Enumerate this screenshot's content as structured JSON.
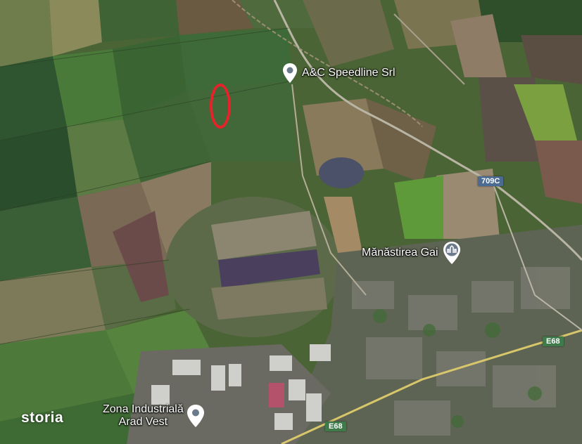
{
  "map": {
    "watermark": "storia",
    "places": {
      "ac_speedline": "A&C Speedline Srl",
      "manastirea_gai": "Mănăstirea Gai",
      "zona_industriala_line1": "Zona Industrială",
      "zona_industriala_line2": "Arad Vest"
    },
    "roads": {
      "r709c": "709C",
      "e68_east": "E68",
      "e68_south": "E68"
    },
    "marker_color": "#e8222b",
    "colors": {
      "label_text": "#ffffff",
      "pin": "#ffffff",
      "pin_inner": "#6b7b8c"
    }
  }
}
